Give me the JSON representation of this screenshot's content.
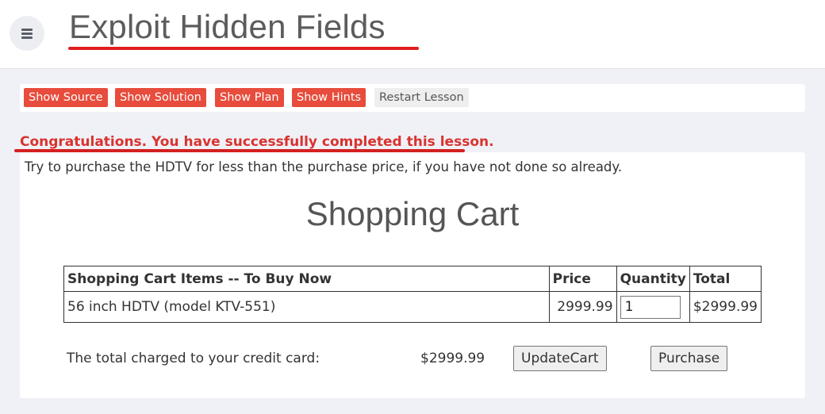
{
  "header": {
    "title": "Exploit Hidden Fields",
    "menu_icon": "hamburger-menu-icon"
  },
  "toolbar": {
    "show_source": "Show Source",
    "show_solution": "Show Solution",
    "show_plan": "Show Plan",
    "show_hints": "Show Hints",
    "restart_lesson": "Restart Lesson"
  },
  "status": {
    "success_message": "Congratulations. You have successfully completed this lesson."
  },
  "lesson": {
    "instructions": "Try to purchase the HDTV for less than the purchase price, if you have not done so already.",
    "cart_title": "Shopping Cart",
    "table": {
      "headers": [
        "Shopping Cart Items -- To Buy Now",
        "Price",
        "Quantity",
        "Total"
      ],
      "rows": [
        {
          "item": "56 inch HDTV (model KTV-551)",
          "price": "2999.99",
          "quantity": "1",
          "total": "$2999.99"
        }
      ]
    },
    "total_label": "The total charged to your credit card:",
    "total_amount": "$2999.99",
    "update_cart_label": "UpdateCart",
    "purchase_label": "Purchase"
  },
  "colors": {
    "accent_red": "#e74c3c",
    "success_red": "#d9332f",
    "page_bg": "#f0f1f6"
  }
}
